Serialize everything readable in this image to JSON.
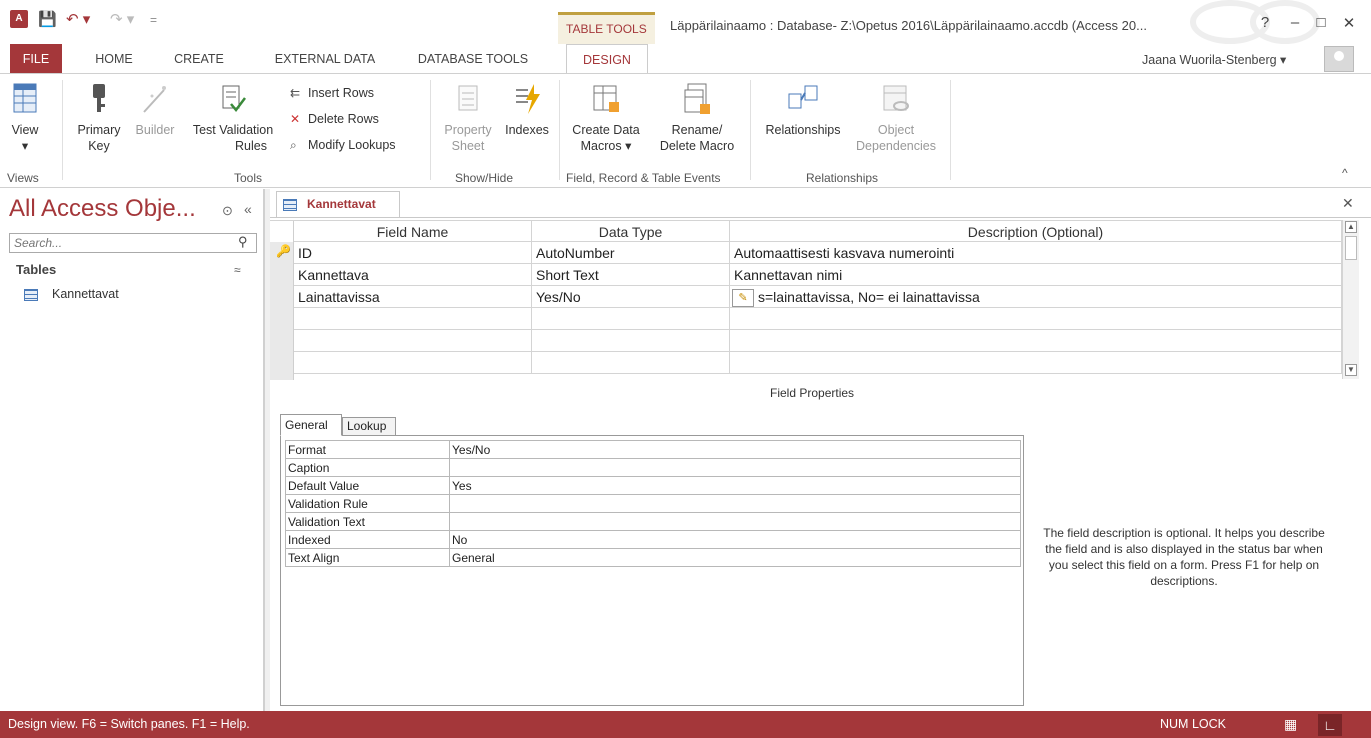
{
  "title_bar": {
    "app_icon": "A",
    "contextual_group": "TABLE TOOLS",
    "document_title": "Läppärilainaamo : Database- Z:\\Opetus 2016\\Läppärilainaamo.accdb (Access 20...",
    "help": "?",
    "minimize": "–",
    "restore": "□",
    "close": "✕"
  },
  "ribbon_tabs": [
    "FILE",
    "HOME",
    "CREATE",
    "EXTERNAL DATA",
    "DATABASE TOOLS",
    "DESIGN"
  ],
  "user": {
    "name": "Jaana Wuorila-Stenberg ▾"
  },
  "ribbon": {
    "views": {
      "view_label": "View",
      "view_arrow": "▾",
      "group": "Views"
    },
    "tools": {
      "primary_key_1": "Primary",
      "primary_key_2": "Key",
      "builder": "Builder",
      "test_validation_1": "Test Validation",
      "test_validation_2": "Rules",
      "insert_rows": "Insert Rows",
      "delete_rows": "Delete Rows",
      "modify_lookups": "Modify Lookups",
      "group": "Tools"
    },
    "show_hide": {
      "property_sheet_1": "Property",
      "property_sheet_2": "Sheet",
      "indexes": "Indexes",
      "group": "Show/Hide"
    },
    "events": {
      "create_macros_1": "Create Data",
      "create_macros_2": "Macros ▾",
      "rename_macro_1": "Rename/",
      "rename_macro_2": "Delete Macro",
      "group": "Field, Record & Table Events"
    },
    "relationships": {
      "relationships": "Relationships",
      "object_deps_1": "Object",
      "object_deps_2": "Dependencies",
      "group": "Relationships"
    },
    "collapse": "^"
  },
  "nav_pane": {
    "title": "All Access Obje...",
    "menu": "⊙",
    "collapse": "«",
    "search_placeholder": "Search...",
    "group": "Tables",
    "group_chevron": "≈",
    "items": [
      {
        "label": "Kannettavat"
      }
    ]
  },
  "document": {
    "tab_label": "Kannettavat",
    "close": "✕",
    "columns": [
      "Field Name",
      "Data Type",
      "Description (Optional)"
    ],
    "rows": [
      {
        "field": "ID",
        "type": "AutoNumber",
        "desc": "Automaattisesti kasvava numerointi",
        "key": true
      },
      {
        "field": "Kannettava",
        "type": "Short Text",
        "desc": "Kannettavan nimi",
        "key": false
      },
      {
        "field": "Lainattavissa",
        "type": "Yes/No",
        "desc": "s=lainattavissa, No= ei lainattavissa",
        "key": false
      }
    ]
  },
  "field_properties": {
    "title": "Field Properties",
    "tabs": [
      "General",
      "Lookup"
    ],
    "properties": [
      {
        "name": "Format",
        "value": "Yes/No"
      },
      {
        "name": "Caption",
        "value": ""
      },
      {
        "name": "Default Value",
        "value": "Yes"
      },
      {
        "name": "Validation Rule",
        "value": ""
      },
      {
        "name": "Validation Text",
        "value": ""
      },
      {
        "name": "Indexed",
        "value": "No"
      },
      {
        "name": "Text Align",
        "value": "General"
      }
    ],
    "help_text": "The field description is optional. It helps you describe the field and is also displayed in the status bar when you select this field on a form. Press F1 for help on descriptions."
  },
  "status_bar": {
    "message": "Design view.  F6 = Switch panes.  F1 = Help.",
    "num_lock": "NUM LOCK"
  },
  "colors": {
    "accent": "#a4373a",
    "context_gold": "#c0a040"
  }
}
